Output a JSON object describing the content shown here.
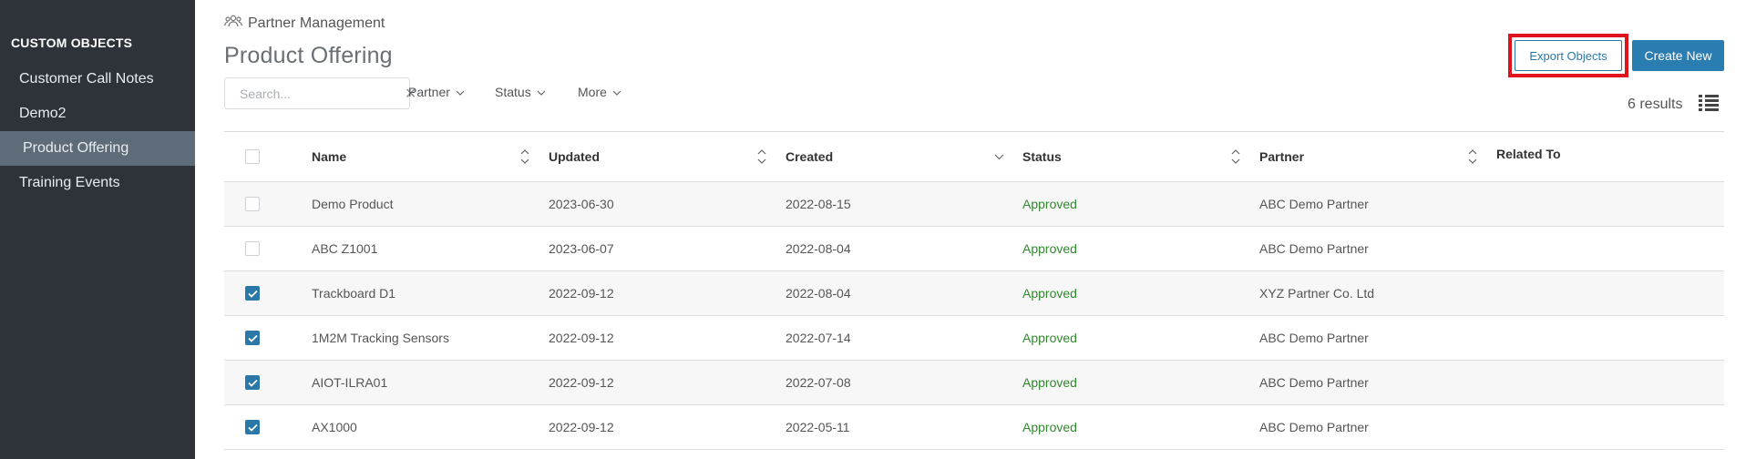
{
  "sidebar": {
    "heading": "CUSTOM OBJECTS",
    "items": [
      {
        "label": "Customer Call Notes",
        "active": false
      },
      {
        "label": "Demo2",
        "active": false
      },
      {
        "label": "Product Offering",
        "active": true
      },
      {
        "label": "Training Events",
        "active": false
      }
    ]
  },
  "header": {
    "breadcrumb": "Partner Management",
    "breadcrumb_icon": "users-icon",
    "title": "Product Offering",
    "export_label": "Export Objects",
    "create_label": "Create New"
  },
  "toolbar": {
    "search_placeholder": "Search...",
    "search_value": "",
    "filters": [
      "Partner",
      "Status",
      "More"
    ],
    "results": "6 results"
  },
  "table": {
    "columns": [
      "Name",
      "Updated",
      "Created",
      "Status",
      "Partner",
      "Related To"
    ],
    "rows": [
      {
        "checked": false,
        "name": "Demo Product",
        "updated": "2023-06-30",
        "created": "2022-08-15",
        "status": "Approved",
        "partner": "ABC Demo Partner",
        "related": ""
      },
      {
        "checked": false,
        "name": "ABC Z1001",
        "updated": "2023-06-07",
        "created": "2022-08-04",
        "status": "Approved",
        "partner": "ABC Demo Partner",
        "related": ""
      },
      {
        "checked": true,
        "name": "Trackboard D1",
        "updated": "2022-09-12",
        "created": "2022-08-04",
        "status": "Approved",
        "partner": "XYZ Partner Co. Ltd",
        "related": ""
      },
      {
        "checked": true,
        "name": "1M2M Tracking Sensors",
        "updated": "2022-09-12",
        "created": "2022-07-14",
        "status": "Approved",
        "partner": "ABC Demo Partner",
        "related": ""
      },
      {
        "checked": true,
        "name": "AIOT-ILRA01",
        "updated": "2022-09-12",
        "created": "2022-07-08",
        "status": "Approved",
        "partner": "ABC Demo Partner",
        "related": ""
      },
      {
        "checked": true,
        "name": "AX1000",
        "updated": "2022-09-12",
        "created": "2022-05-11",
        "status": "Approved",
        "partner": "ABC Demo Partner",
        "related": ""
      }
    ]
  },
  "colors": {
    "sidebar_bg": "#2d3339",
    "sidebar_active": "#5e6c79",
    "accent": "#2a78a8",
    "approved": "#2f8a2c",
    "highlight": "#e0121e"
  }
}
